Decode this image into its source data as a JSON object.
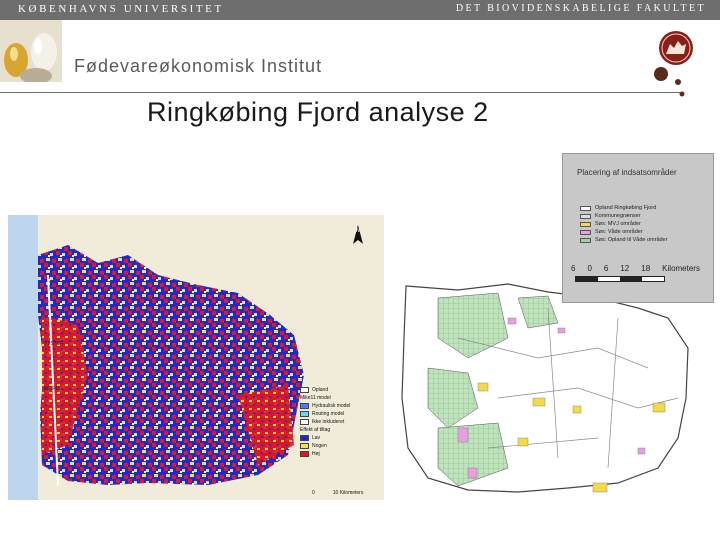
{
  "header": {
    "university": "KØBENHAVNS UNIVERSITET",
    "faculty": "DET BIOVIDENSKABELIGE FAKULTET",
    "institute": "Fødevareøkonomisk Institut"
  },
  "slide": {
    "title": "Ringkøbing Fjord analyse 2"
  },
  "legend_left": {
    "items": [
      {
        "label": "Opland",
        "color": "#ffffff"
      },
      {
        "label": "Mike11 model",
        "color": "#ffffff"
      },
      {
        "label": "Hydraulisk model",
        "color": "#5577ff"
      },
      {
        "label": "Routing model",
        "color": "#66ddee"
      },
      {
        "label": "Ikke inkluderet",
        "color": "#ffffff"
      },
      {
        "label": "Effekt af tiltag",
        "color": "#ffffff"
      },
      {
        "label": "Lav",
        "color": "#1a2bd6"
      },
      {
        "label": "Nogen",
        "color": "#f0e060"
      },
      {
        "label": "Høj",
        "color": "#e8161a"
      }
    ],
    "scale_start": "0",
    "scale_end": "10 Kilometers"
  },
  "legend_right": {
    "title": "Placering af indsatsområder",
    "items": [
      {
        "label": "Opland Ringkøbing Fjord",
        "color": "#ffffff"
      },
      {
        "label": "Kommunegrænser",
        "color": "#dddddd"
      },
      {
        "label": "Søs: MVJ områder",
        "color": "#f4d94a"
      },
      {
        "label": "Søs: Våde områder",
        "color": "#e89ee0"
      },
      {
        "label": "Søs: Opland til Våde områder",
        "color": "#9ed39b"
      }
    ],
    "scale_labels": [
      "6",
      "0",
      "6",
      "12",
      "18",
      "Kilometers"
    ]
  },
  "colors": {
    "topbar": "#6e6e6e",
    "logo_red": "#8a1e18",
    "logo_brown": "#5a2b1c"
  }
}
